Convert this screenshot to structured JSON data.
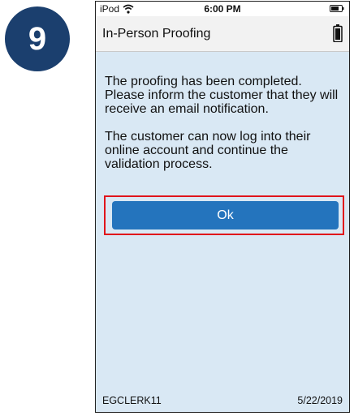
{
  "step": {
    "number": "9"
  },
  "status_bar": {
    "device": "iPod",
    "time": "6:00 PM"
  },
  "header": {
    "title": "In-Person Proofing"
  },
  "message": {
    "paragraph1": "The proofing has been completed. Please inform the customer that they will receive an email notification.",
    "paragraph2": "The customer can now log into their online account and continue the validation process."
  },
  "ok_button": {
    "label": "Ok"
  },
  "footer": {
    "user": "EGCLERK11",
    "date": "5/22/2019"
  },
  "colors": {
    "badge": "#1b3f6e",
    "screen_background": "#d9e8f4",
    "button": "#2474bd",
    "highlight": "#e0141b"
  },
  "icons": {
    "status_wifi": "wifi-icon",
    "status_battery": "battery-icon",
    "header_battery": "battery-icon"
  }
}
